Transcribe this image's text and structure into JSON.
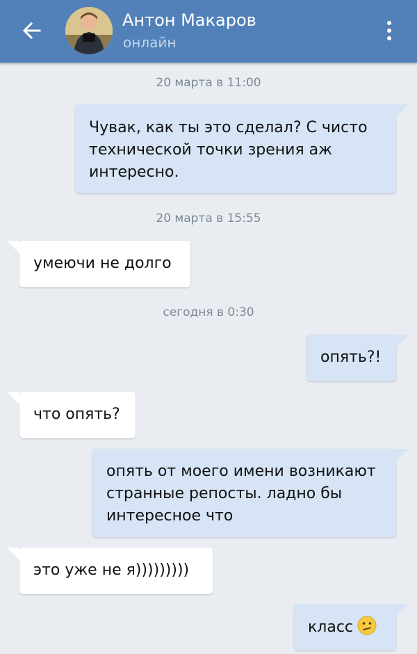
{
  "header": {
    "contact_name": "Антон Макаров",
    "status": "онлайн",
    "accent_color": "#5181b8"
  },
  "icons": {
    "back": "arrow-left-icon",
    "menu": "more-vertical-icon",
    "emoji": "confused-face-emoji"
  },
  "messages": {
    "sep1": "20 марта в 11:00",
    "m1": "Чувак, как ты это сделал? С чисто технической точки зрения аж интересно.",
    "sep2": "20 марта в 15:55",
    "m2": "умеючи не долго",
    "sep3": "сегодня в 0:30",
    "m3": "опять?!",
    "m4": "что опять?",
    "m5": "опять от моего имени возникают странные репосты. ладно бы интересное что",
    "m6": "это уже не я)))))))))",
    "m7": "класс"
  }
}
